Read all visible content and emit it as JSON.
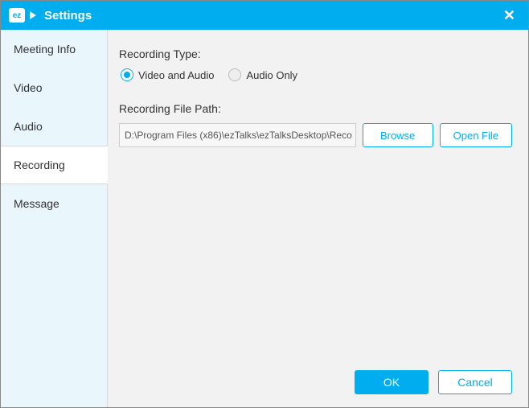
{
  "title": "Settings",
  "logo_text": "ez",
  "sidebar": {
    "items": [
      {
        "label": "Meeting Info"
      },
      {
        "label": "Video"
      },
      {
        "label": "Audio"
      },
      {
        "label": "Recording"
      },
      {
        "label": "Message"
      }
    ],
    "active_index": 3
  },
  "recording": {
    "type_label": "Recording Type:",
    "option_video_audio": "Video and Audio",
    "option_audio_only": "Audio Only",
    "selected_option": "video_audio",
    "path_label": "Recording File Path:",
    "path_value": "D:\\Program Files (x86)\\ezTalks\\ezTalksDesktop\\Reco",
    "browse_label": "Browse",
    "open_file_label": "Open File"
  },
  "footer": {
    "ok_label": "OK",
    "cancel_label": "Cancel"
  }
}
